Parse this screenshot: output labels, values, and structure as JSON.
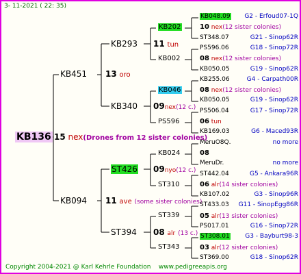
{
  "timestamp": "3- 11-2021 ( 22: 35)",
  "footer": {
    "copyright": "Copyright 2004-2021 @ Karl Kehrle Foundation",
    "url": "www.pedigreeapis.org"
  },
  "colors": {
    "border": "#e000e0",
    "green_hl": "#22dd22",
    "cyan_hl": "#33ccee",
    "root_hl": "#f0c8f5"
  },
  "root": {
    "name": "KB136",
    "qn": "15",
    "mating": "nex",
    "note": "(Drones from 12 sister colonies)"
  },
  "gen1": {
    "top": {
      "name": "KB451",
      "qn": "13",
      "mating": "oro"
    },
    "bottom": {
      "name": "KB094",
      "qn": "11",
      "mating": "ave",
      "note": "(some sister colonies)"
    }
  },
  "gen2": {
    "a": {
      "name": "KB293",
      "qn": "11",
      "mating": "tun"
    },
    "b": {
      "name": "KB340",
      "qn": "09",
      "mating": "nex",
      "note": "(12 c.)"
    },
    "c": {
      "name": "ST426",
      "qn": "09",
      "mating": "nyo",
      "note": "(12 c.)"
    },
    "d": {
      "name": "ST394",
      "qn": "08",
      "mating": "alr",
      "note": "(13 c.)"
    }
  },
  "gen3": {
    "a1": {
      "name": "KB202"
    },
    "a2": {
      "name": "KB002"
    },
    "b1": {
      "name": "KB046"
    },
    "b2": {
      "name": "PS596"
    },
    "c1": {
      "name": "KB024"
    },
    "c2": {
      "name": "ST310"
    },
    "d1": {
      "name": "ST339"
    },
    "d2": {
      "name": "ST343"
    }
  },
  "leaves": [
    {
      "id": "KB048.09",
      "right": "G2 - Erfoud07-1Q"
    },
    {
      "qn": "10",
      "mating": "nex",
      "note": "(12 sister colonies)"
    },
    {
      "id": "ST348.07",
      "right": "G21 - Sinop62R"
    },
    {
      "id": "PS596.06",
      "right": "G18 - Sinop72R"
    },
    {
      "qn": "08",
      "mating": "nex",
      "note": "(12 sister colonies)"
    },
    {
      "id": "KB050.05",
      "right": "G19 - Sinop62R"
    },
    {
      "id": "KB255.06",
      "right": "G4 - Carpath00R"
    },
    {
      "qn": "08",
      "mating": "nex",
      "note": "(12 sister colonies)"
    },
    {
      "id": "KB050.05",
      "right": "G19 - Sinop62R"
    },
    {
      "id": "PS506.04",
      "right": "G17 - Sinop72R"
    },
    {
      "qn": "06",
      "mating": "tun",
      "note": ""
    },
    {
      "id": "KB169.03",
      "right": "G6 - Maced93R"
    },
    {
      "id": "MeruO8Q.",
      "right": "no more"
    },
    {
      "qn": "08",
      "mating": "",
      "note": ""
    },
    {
      "id": "MeruDr.",
      "right": "no more"
    },
    {
      "id": "ST442.04",
      "right": "G5 - Ankara96R"
    },
    {
      "qn": "06",
      "mating": "alr",
      "note": "(14 sister colonies)"
    },
    {
      "id": "KB107.02",
      "right": "G3 - Sinop96R"
    },
    {
      "id": "ST433.03",
      "right": "G11 - SinopEgg86R"
    },
    {
      "qn": "05",
      "mating": "alr",
      "note": "(13 sister colonies)"
    },
    {
      "id": "PS017.01",
      "right": "G16 - Sinop72R"
    },
    {
      "id": "ST308.01",
      "right": "G3 - Bayburt98-3"
    },
    {
      "qn": "03",
      "mating": "alr",
      "note": "(12 sister colonies)"
    },
    {
      "id": "ST369.00",
      "right": "G18 - Sinop62R"
    }
  ]
}
